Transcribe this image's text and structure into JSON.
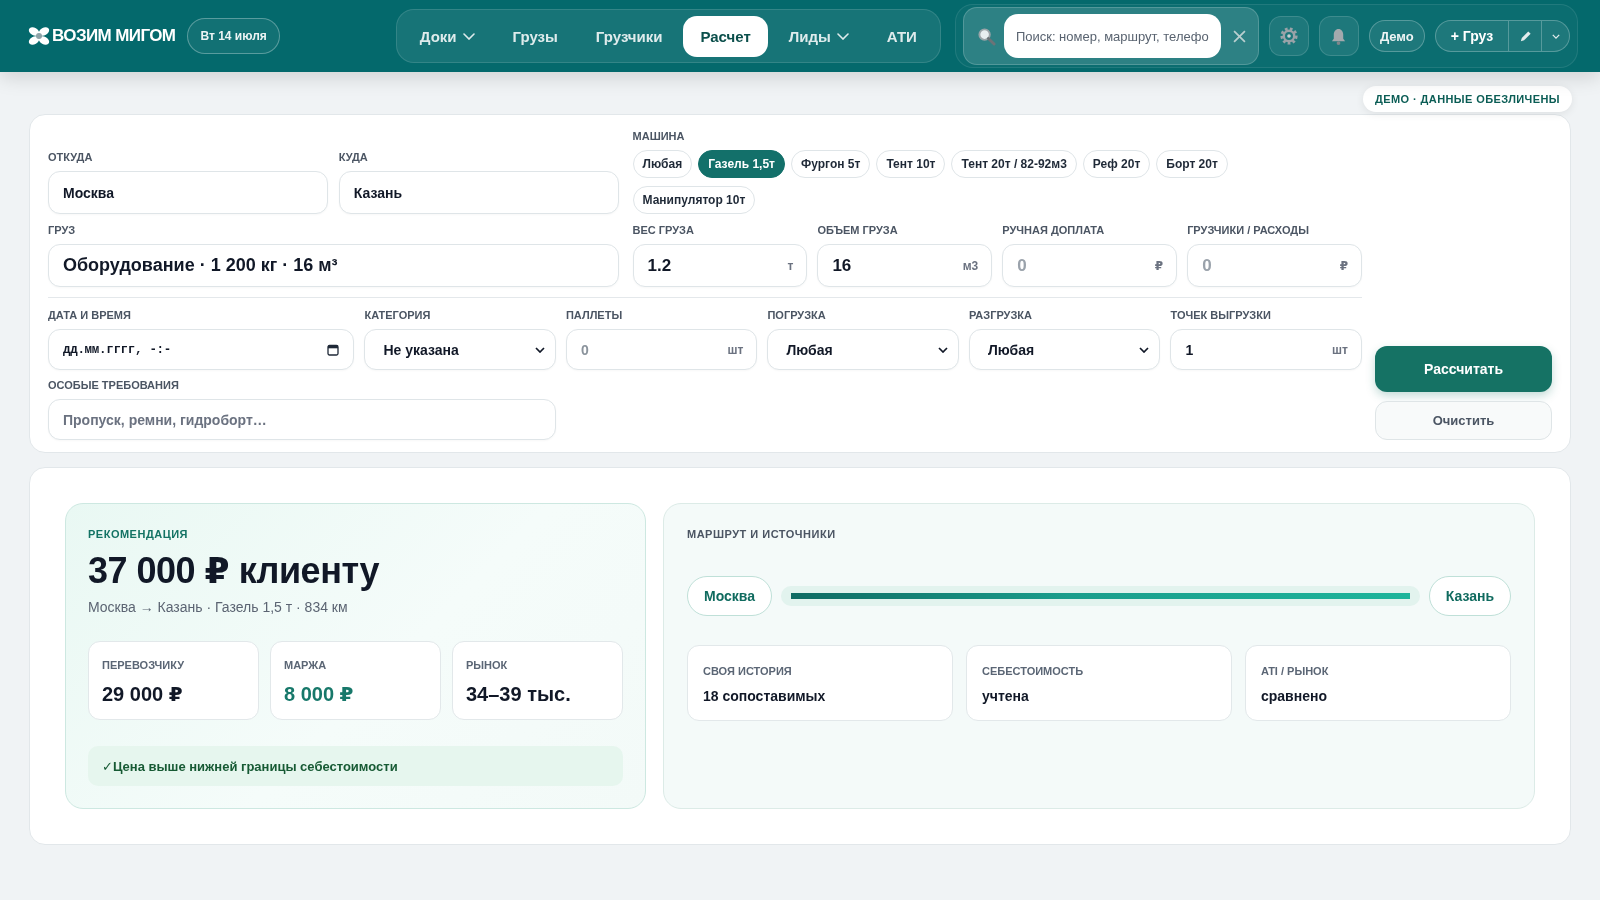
{
  "header": {
    "logo": "ВОЗИМ МИГОМ",
    "date": "Вт 14 июля",
    "nav": [
      {
        "label": "Доки",
        "selected": false,
        "dropdown": true
      },
      {
        "label": "Грузы",
        "selected": false,
        "dropdown": false
      },
      {
        "label": "Грузчики",
        "selected": false,
        "dropdown": false
      },
      {
        "label": "Расчет",
        "selected": true,
        "dropdown": false
      },
      {
        "label": "Лиды",
        "selected": false,
        "dropdown": true
      },
      {
        "label": "АТИ",
        "selected": false,
        "dropdown": false
      }
    ],
    "search": {
      "placeholder": "Поиск: номер, маршрут, телефо"
    },
    "mode_button": "Демо",
    "add_button": "+ Груз"
  },
  "demo_badge": "ДЕМО · ДАННЫЕ ОБЕЗЛИЧЕНЫ",
  "form": {
    "from": {
      "label": "ОТКУДА",
      "value": "Москва"
    },
    "to": {
      "label": "КУДА",
      "value": "Казань"
    },
    "vehicle": {
      "label": "МАШИНА",
      "options": [
        {
          "label": "Любая",
          "selected": false
        },
        {
          "label": "Газель 1,5т",
          "selected": true
        },
        {
          "label": "Фургон 5т",
          "selected": false
        },
        {
          "label": "Тент 10т",
          "selected": false
        },
        {
          "label": "Тент 20т / 82-92м3",
          "selected": false
        },
        {
          "label": "Реф 20т",
          "selected": false
        },
        {
          "label": "Борт 20т",
          "selected": false
        },
        {
          "label": "Манипулятор 10т",
          "selected": false
        }
      ]
    },
    "cargo": {
      "label": "ГРУЗ",
      "value": "Оборудование · 1 200 кг · 16 м³"
    },
    "measures": [
      {
        "label": "ВЕС ГРУЗА",
        "value": "1.2",
        "unit": "т"
      },
      {
        "label": "ОБЪЕМ ГРУЗА",
        "value": "16",
        "unit": "м3"
      },
      {
        "label": "РУЧНАЯ ДОПЛАТА",
        "placeholder": "0",
        "unit": "₽"
      },
      {
        "label": "ГРУЗЧИКИ / РАСХОДЫ",
        "placeholder": "0",
        "unit": "₽"
      }
    ],
    "details": [
      {
        "kind": "date",
        "label": "ДАТА И ВРЕМЯ",
        "placeholder": "дд.мм.гггг, -:-"
      },
      {
        "kind": "select",
        "label": "КАТЕГОРИЯ",
        "value": "Не указана"
      },
      {
        "kind": "number",
        "label": "ПАЛЛЕТЫ",
        "placeholder": "0",
        "unit": "шт"
      },
      {
        "kind": "select",
        "label": "ПОГРУЗКА",
        "value": "Любая"
      },
      {
        "kind": "select",
        "label": "РАЗГРУЗКА",
        "value": "Любая"
      },
      {
        "kind": "number",
        "label": "ТОЧЕК ВЫГРУЗКИ",
        "value": "1",
        "unit": "шт"
      }
    ],
    "requirements": {
      "label": "ОСОБЫЕ ТРЕБОВАНИЯ",
      "placeholder": "Пропуск, ремни, гидроборт…"
    },
    "buttons": [
      {
        "label": "Рассчитать",
        "kind": "primary"
      },
      {
        "label": "Очистить",
        "kind": "secondary"
      }
    ]
  },
  "recommendation": {
    "label": "РЕКОМЕНДАЦИЯ",
    "price": "37 000 ₽ клиенту",
    "summary": "Москва → Казань · Газель 1,5 т · 834 км",
    "stats": [
      {
        "label": "ПЕРЕВОЗЧИКУ",
        "value": "29 000 ₽",
        "accent": false
      },
      {
        "label": "МАРЖА",
        "value": "8 000 ₽",
        "accent": true
      },
      {
        "label": "РЫНОК",
        "value": "34–39 тыс.",
        "accent": false
      }
    ],
    "note": "✓Цена выше нижней границы себестоимости"
  },
  "route": {
    "title": "МАРШРУТ И ИСТОЧНИКИ",
    "from": "Москва",
    "to": "Казань",
    "sources": [
      {
        "label": "СВОЯ ИСТОРИЯ",
        "value": "18 сопоставимых"
      },
      {
        "label": "СЕБЕСТОИМОСТЬ",
        "value": "учтена"
      },
      {
        "label": "ATI / РЫНОК",
        "value": "сравнено"
      }
    ]
  }
}
